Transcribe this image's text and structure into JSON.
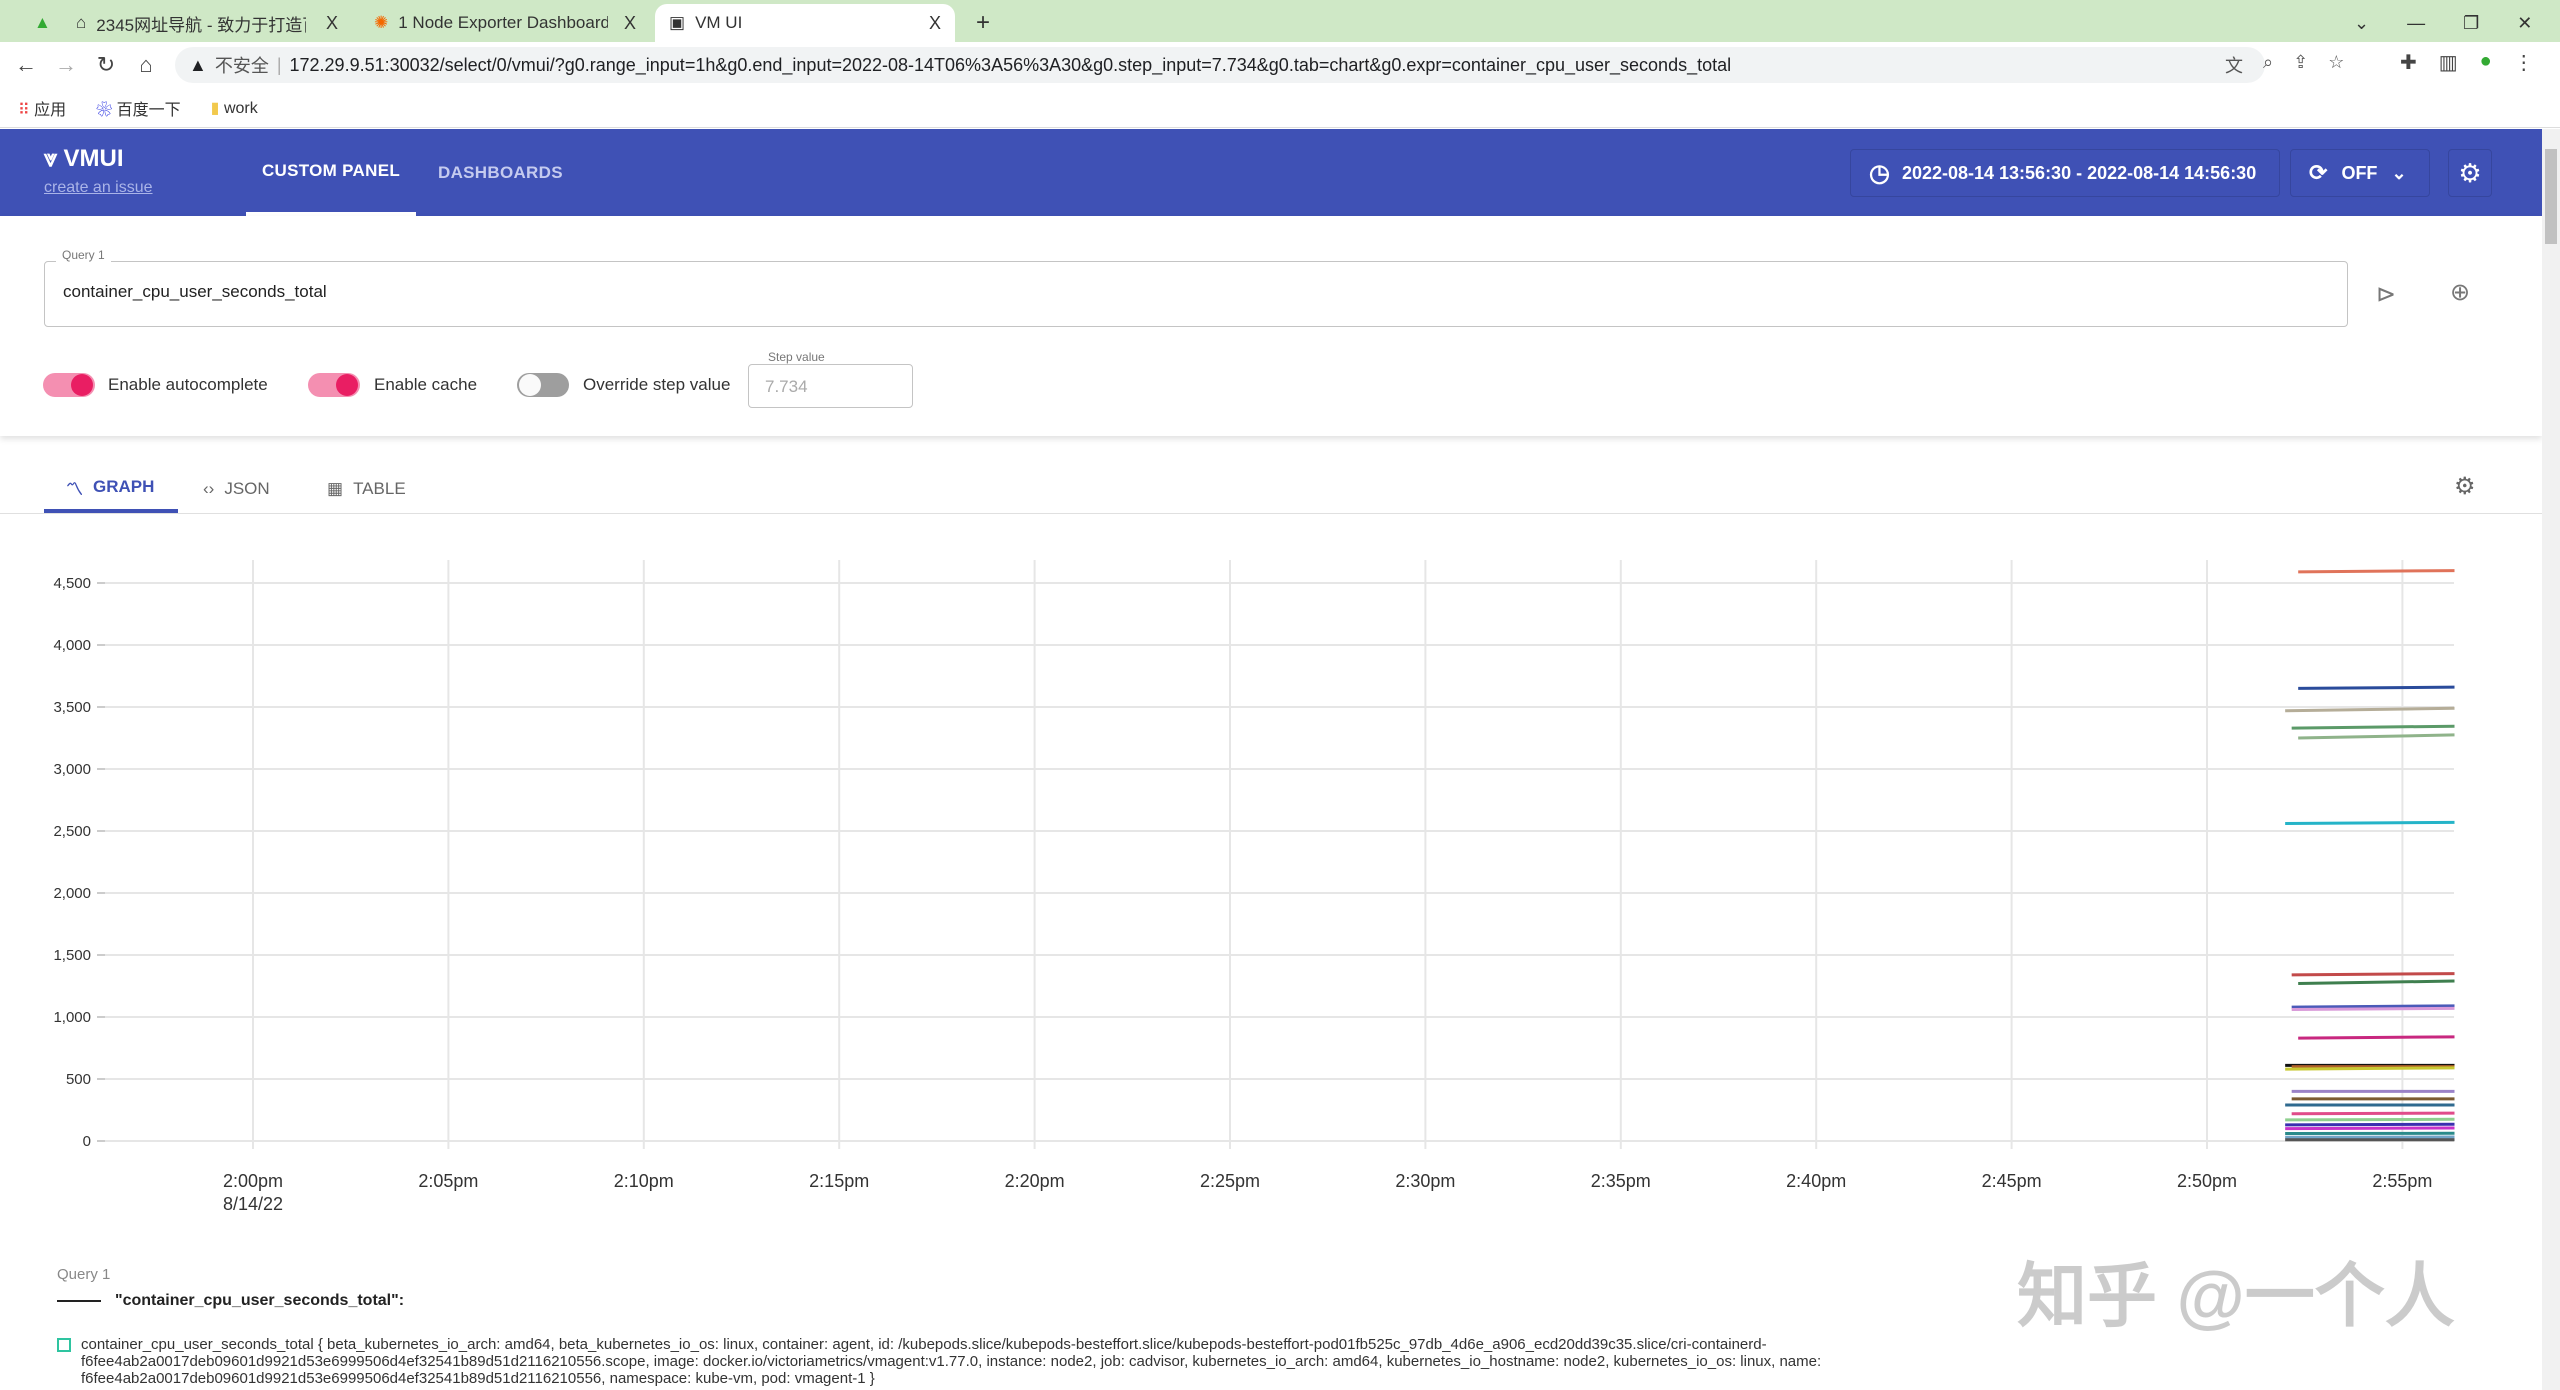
{
  "browser": {
    "tabs": [
      {
        "title": "2345网址导航 - 致力于打造百年",
        "close": "X"
      },
      {
        "title": "1 Node Exporter Dashboard 2",
        "close": "X"
      },
      {
        "title": "VM UI",
        "close": "X"
      }
    ],
    "new_tab": "+",
    "security": "不安全",
    "url": "172.29.9.51:30032/select/0/vmui/?g0.range_input=1h&g0.end_input=2022-08-14T06%3A56%3A30&g0.step_input=7.734&g0.tab=chart&g0.expr=container_cpu_user_seconds_total",
    "bookmarks": [
      "应用",
      "百度一下",
      "work"
    ]
  },
  "header": {
    "logo": "VMUI",
    "issue_link": "create an issue",
    "nav": [
      "CUSTOM PANEL",
      "DASHBOARDS"
    ],
    "time_range": "2022-08-14 13:56:30 - 2022-08-14 14:56:30",
    "refresh": "OFF",
    "accent": "#3f51b5"
  },
  "query": {
    "label": "Query 1",
    "value": "container_cpu_user_seconds_total",
    "toggles": [
      {
        "label": "Enable autocomplete",
        "on": true
      },
      {
        "label": "Enable cache",
        "on": true
      },
      {
        "label": "Override step value",
        "on": false
      }
    ],
    "step_label": "Step value",
    "step_value": "7.734"
  },
  "view_tabs": [
    "GRAPH",
    "JSON",
    "TABLE"
  ],
  "chart_data": {
    "type": "line",
    "y_ticks": [
      "0",
      "500",
      "1,000",
      "1,500",
      "2,000",
      "2,500",
      "3,000",
      "3,500",
      "4,000",
      "4,500"
    ],
    "ylim": [
      0,
      4700
    ],
    "x_ticks": [
      "2:00pm",
      "2:05pm",
      "2:10pm",
      "2:15pm",
      "2:20pm",
      "2:25pm",
      "2:30pm",
      "2:35pm",
      "2:40pm",
      "2:45pm",
      "2:50pm",
      "2:55pm"
    ],
    "x_date": "8/14/22",
    "x_range": [
      "13:56:30",
      "14:56:30"
    ],
    "grid": true,
    "series": [
      {
        "color": "#e0735a",
        "x": [
          "14:52:20",
          "14:56:20"
        ],
        "values": [
          4590,
          4600
        ]
      },
      {
        "color": "#2a4b9b",
        "x": [
          "14:52:20",
          "14:56:20"
        ],
        "values": [
          3650,
          3660
        ]
      },
      {
        "color": "#b5ad98",
        "x": [
          "14:52:00",
          "14:56:20"
        ],
        "values": [
          3470,
          3490
        ]
      },
      {
        "color": "#5b9a68",
        "x": [
          "14:52:10",
          "14:56:20"
        ],
        "values": [
          3330,
          3345
        ]
      },
      {
        "color": "#8fb38a",
        "x": [
          "14:52:20",
          "14:56:20"
        ],
        "values": [
          3250,
          3275
        ]
      },
      {
        "color": "#25b4c8",
        "x": [
          "14:52:00",
          "14:56:20"
        ],
        "values": [
          2560,
          2570
        ]
      },
      {
        "color": "#c24a4a",
        "x": [
          "14:52:10",
          "14:56:20"
        ],
        "values": [
          1340,
          1350
        ]
      },
      {
        "color": "#3f7f4f",
        "x": [
          "14:52:20",
          "14:56:20"
        ],
        "values": [
          1270,
          1290
        ]
      },
      {
        "color": "#4a5ab8",
        "x": [
          "14:52:10",
          "14:56:20"
        ],
        "values": [
          1080,
          1090
        ]
      },
      {
        "color": "#d99ad9",
        "x": [
          "14:52:10",
          "14:56:20"
        ],
        "values": [
          1060,
          1070
        ]
      },
      {
        "color": "#c8287f",
        "x": [
          "14:52:20",
          "14:56:20"
        ],
        "values": [
          830,
          840
        ]
      },
      {
        "color": "#111111",
        "x": [
          "14:52:00",
          "14:56:20"
        ],
        "values": [
          610,
          610
        ]
      },
      {
        "color": "#b0602a",
        "x": [
          "14:52:10",
          "14:56:20"
        ],
        "values": [
          600,
          600
        ]
      },
      {
        "color": "#c8c832",
        "x": [
          "14:52:00",
          "14:56:20"
        ],
        "values": [
          580,
          590
        ]
      },
      {
        "color": "#9a82c8",
        "x": [
          "14:52:10",
          "14:56:20"
        ],
        "values": [
          400,
          400
        ]
      },
      {
        "color": "#7a5a32",
        "x": [
          "14:52:10",
          "14:56:20"
        ],
        "values": [
          340,
          340
        ]
      },
      {
        "color": "#2f6a8f",
        "x": [
          "14:52:00",
          "14:56:20"
        ],
        "values": [
          290,
          290
        ]
      },
      {
        "color": "#e04c8a",
        "x": [
          "14:52:10",
          "14:56:20"
        ],
        "values": [
          220,
          225
        ]
      },
      {
        "color": "#8fd08f",
        "x": [
          "14:52:00",
          "14:56:20"
        ],
        "values": [
          170,
          175
        ]
      },
      {
        "color": "#3a2fb0",
        "x": [
          "14:52:00",
          "14:56:20"
        ],
        "values": [
          130,
          135
        ]
      },
      {
        "color": "#c832c8",
        "x": [
          "14:52:00",
          "14:56:20"
        ],
        "values": [
          100,
          105
        ]
      },
      {
        "color": "#2a8a8a",
        "x": [
          "14:52:00",
          "14:56:20"
        ],
        "values": [
          60,
          62
        ]
      },
      {
        "color": "#72a5c8",
        "x": [
          "14:52:00",
          "14:56:20"
        ],
        "values": [
          30,
          32
        ]
      },
      {
        "color": "#555555",
        "x": [
          "14:52:00",
          "14:56:20"
        ],
        "values": [
          10,
          10
        ]
      }
    ]
  },
  "legend": {
    "query": "Query 1",
    "title": "\"container_cpu_user_seconds_total\":",
    "series_color": "#2ec4a0",
    "series_text": "container_cpu_user_seconds_total { beta_kubernetes_io_arch: amd64, beta_kubernetes_io_os: linux, container: agent, id: /kubepods.slice/kubepods-besteffort.slice/kubepods-besteffort-pod01fb525c_97db_4d6e_a906_ecd20dd39c35.slice/cri-containerd-f6fee4ab2a0017deb09601d9921d53e6999506d4ef32541b89d51d2116210556.scope, image: docker.io/victoriametrics/vmagent:v1.77.0, instance: node2, job: cadvisor, kubernetes_io_arch: amd64, kubernetes_io_hostname: node2, kubernetes_io_os: linux, name: f6fee4ab2a0017deb09601d9921d53e6999506d4ef32541b89d51d2116210556, namespace: kube-vm, pod: vmagent-1 }"
  },
  "watermark": "知乎 @一个人"
}
